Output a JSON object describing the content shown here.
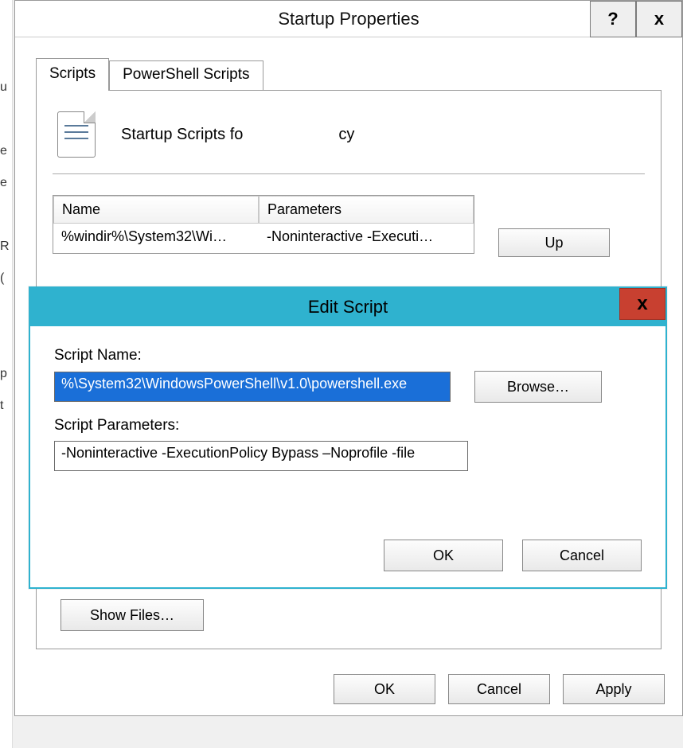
{
  "parent": {
    "title": "Startup Properties",
    "help_label": "?",
    "close_label": "x",
    "tabs": [
      {
        "label": "Scripts"
      },
      {
        "label": "PowerShell Scripts"
      }
    ],
    "header_text_a": "Startup Scripts fo",
    "header_text_b": "cy",
    "columns": {
      "name": "Name",
      "parameters": "Parameters"
    },
    "rows": [
      {
        "name": "%windir%\\System32\\Wi…",
        "parameters": "-Noninteractive -Executi…"
      }
    ],
    "buttons": {
      "up": "Up",
      "show_files": "Show Files…",
      "ok": "OK",
      "cancel": "Cancel",
      "apply": "Apply"
    }
  },
  "child": {
    "title": "Edit Script",
    "close_label": "x",
    "script_name_label": "Script Name:",
    "script_name_value": "%\\System32\\WindowsPowerShell\\v1.0\\powershell.exe",
    "script_params_label": "Script Parameters:",
    "script_params_value": "-Noninteractive -ExecutionPolicy Bypass –Noprofile -file",
    "buttons": {
      "browse": "Browse…",
      "ok": "OK",
      "cancel": "Cancel"
    }
  }
}
